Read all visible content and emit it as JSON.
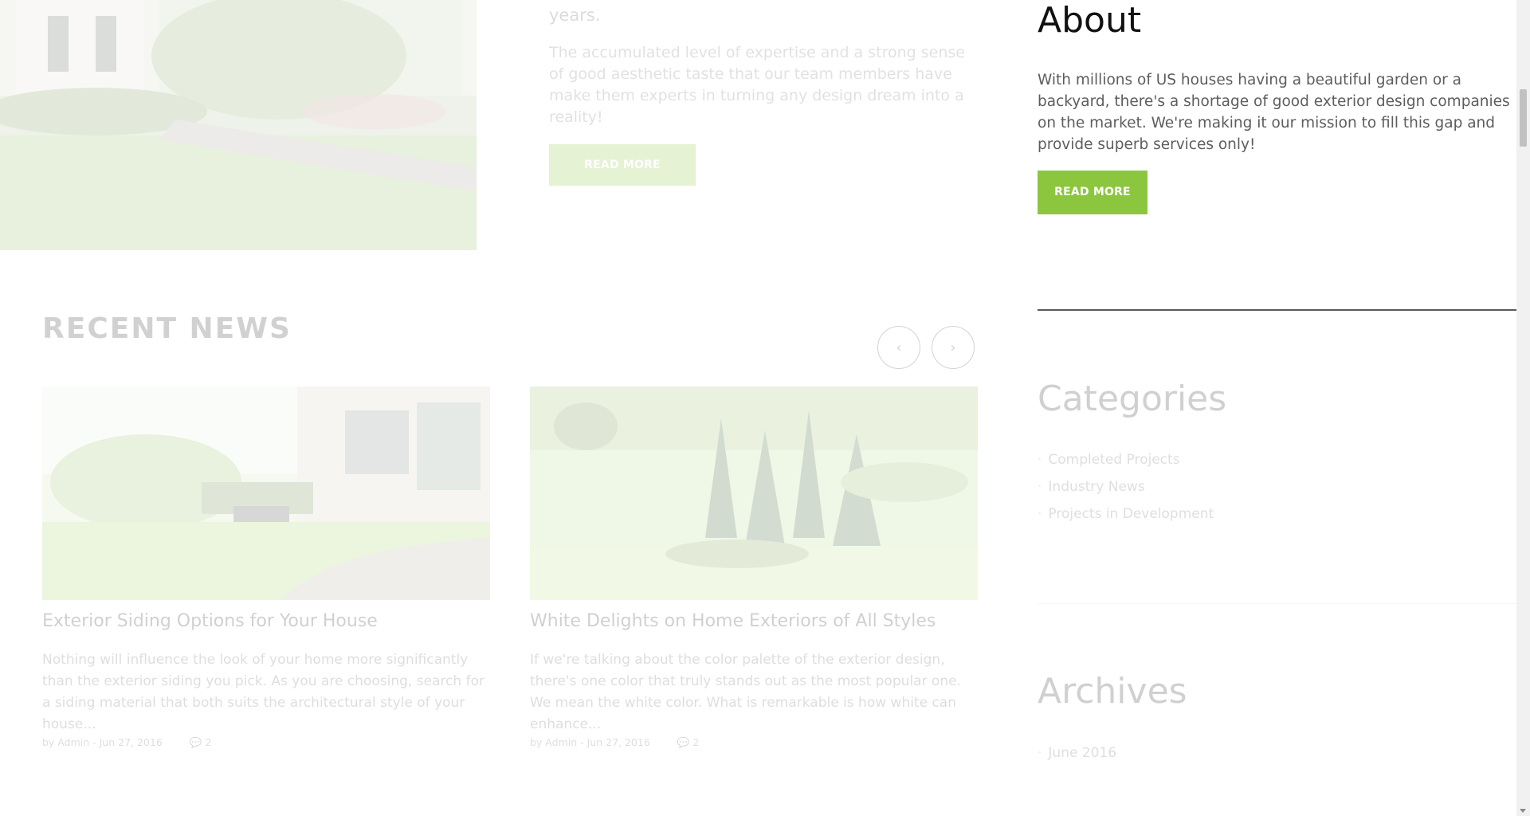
{
  "intro": {
    "lead_fragment": "years.",
    "paragraph": "The accumulated level of expertise and a strong sense of good aesthetic taste that our team members have make them experts in turning any design dream into a reality!",
    "read_more": "READ MORE"
  },
  "recent_news": {
    "title": "RECENT NEWS",
    "cards": [
      {
        "title": "Exterior Siding Options for Your House",
        "excerpt": "Nothing will influence the look of your home more significantly than the exterior siding you pick. As you are choosing, search for a siding material that both suits the architectural style of your house...",
        "meta_by": "by Admin",
        "meta_date": "Jun 27, 2016",
        "comments": "2"
      },
      {
        "title": "White Delights on Home Exteriors of All Styles",
        "excerpt": "If we're talking about the color palette of the exterior design, there's one color that truly stands out as the most popular one. We mean the white color. What is remarkable is how white can enhance...",
        "meta_by": "by Admin",
        "meta_date": "Jun 27, 2016",
        "comments": "2"
      }
    ]
  },
  "sidebar": {
    "about_title": "About",
    "about_text": "With millions of US houses having a beautiful garden or a backyard, there's a shortage of good exterior design companies on the market. We're making it our mission to fill this gap and provide superb services only!",
    "about_button": "READ MORE",
    "categories_title": "Categories",
    "categories": [
      "Completed Projects",
      "Industry News",
      "Projects in Development"
    ],
    "archives_title": "Archives",
    "archives": [
      "June 2016"
    ]
  },
  "colors": {
    "accent": "#8cc63f",
    "text_dark": "#111111",
    "text_body": "#5d5d5d"
  },
  "icons": {
    "prev": "chevron-left-icon",
    "next": "chevron-right-icon",
    "comment": "comment-icon"
  }
}
